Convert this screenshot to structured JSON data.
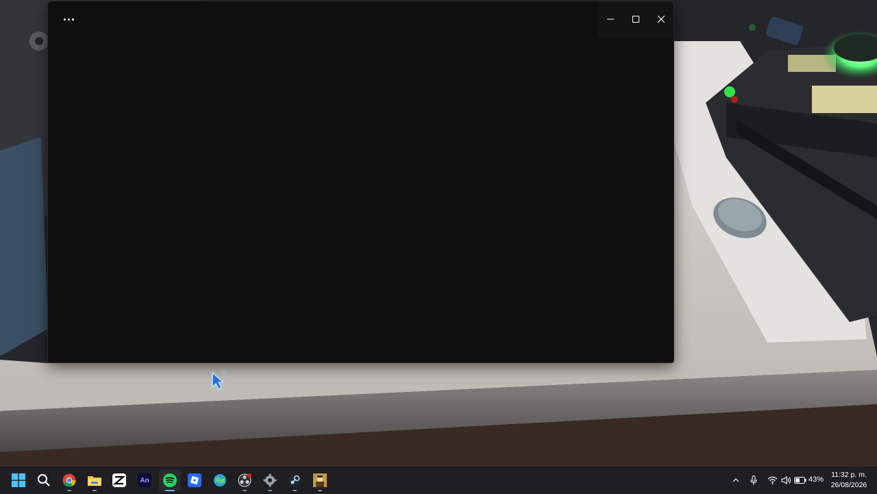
{
  "window": {
    "more_label": "...",
    "controls": [
      "minimize",
      "maximize",
      "close"
    ]
  },
  "taskbar": {
    "apps": [
      {
        "name": "start-icon",
        "active": false
      },
      {
        "name": "search-icon",
        "active": false
      },
      {
        "name": "chrome-icon",
        "active": false
      },
      {
        "name": "file-explorer-icon",
        "active": false
      },
      {
        "name": "capcut-icon",
        "active": false
      },
      {
        "name": "adobe-animate-icon",
        "label": "An",
        "active": false
      },
      {
        "name": "spotify-icon",
        "active": true
      },
      {
        "name": "roblox-studio-icon",
        "active": false
      },
      {
        "name": "globe-app-icon",
        "active": false
      },
      {
        "name": "obs-icon",
        "active": false
      },
      {
        "name": "settings-icon",
        "active": false
      },
      {
        "name": "steam-icon",
        "active": false
      },
      {
        "name": "game-avatar-icon",
        "active": false
      }
    ],
    "tray": {
      "battery_percent": "43%",
      "time": "11:32 p. m.",
      "date": "26/08/2026"
    }
  },
  "colors": {
    "accent": "#5fb3f5",
    "spotify": "#1ed760",
    "window_bg": "#0f0f0f",
    "taskbar_bg": "#1f1f22"
  }
}
